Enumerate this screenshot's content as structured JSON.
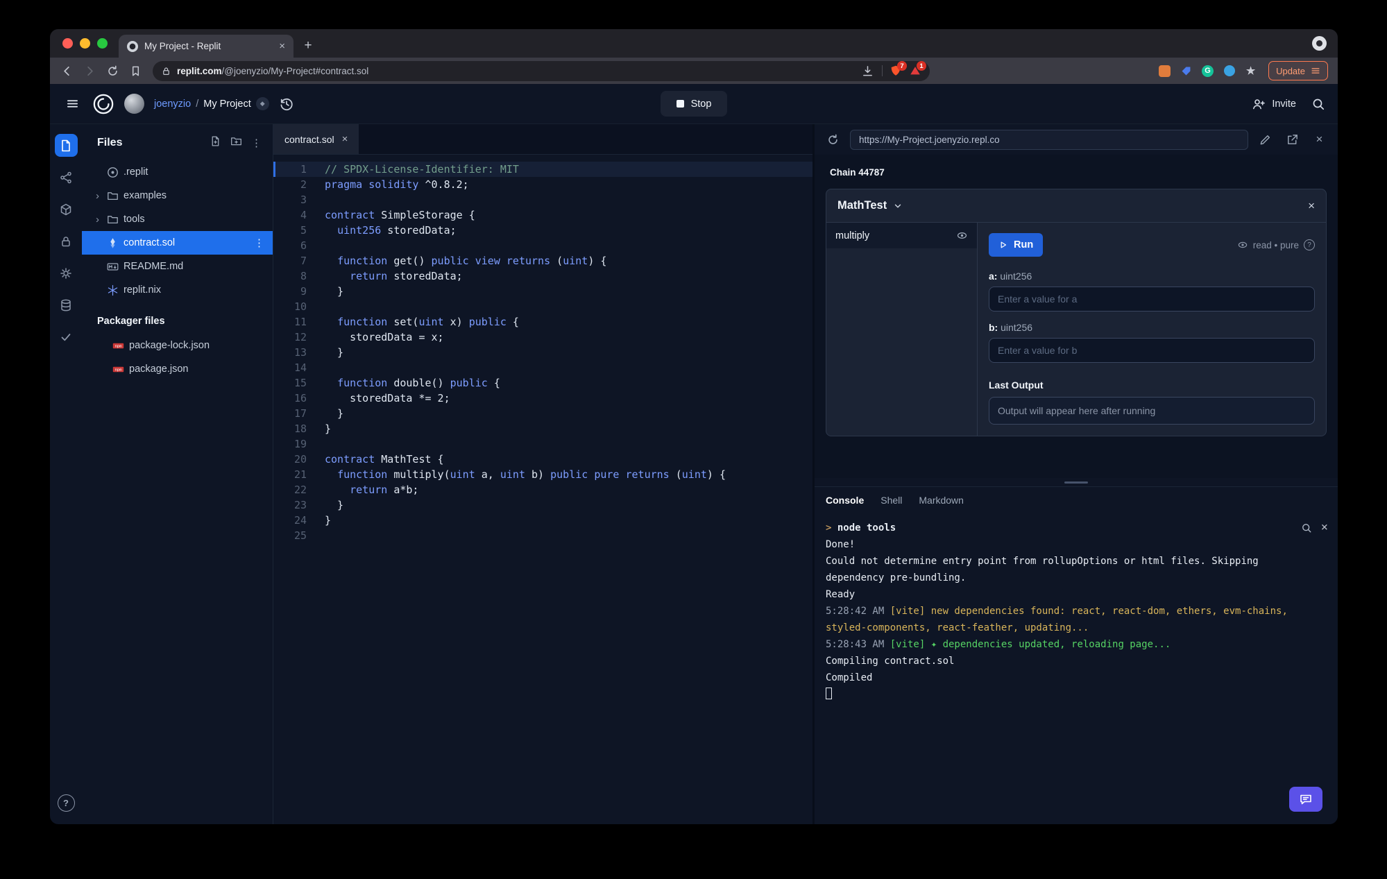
{
  "browser": {
    "tab_title": "My Project - Replit",
    "url_domain": "replit.com",
    "url_path": "/@joenyzio/My-Project#contract.sol",
    "shield_badge": "7",
    "alert_badge": "1",
    "update_label": "Update",
    "extension_letter": "G"
  },
  "header": {
    "username": "joenyzio",
    "separator": "/",
    "project_name": "My Project",
    "stop_label": "Stop",
    "invite_label": "Invite"
  },
  "rail": [
    {
      "name": "tool-files",
      "icon": "files-icon",
      "active": true
    },
    {
      "name": "tool-version-control",
      "icon": "version-control-icon"
    },
    {
      "name": "tool-packages",
      "icon": "packages-icon"
    },
    {
      "name": "tool-secrets",
      "icon": "secrets-icon"
    },
    {
      "name": "tool-settings",
      "icon": "settings-icon"
    },
    {
      "name": "tool-database",
      "icon": "database-icon"
    },
    {
      "name": "tool-checks",
      "icon": "check-icon"
    }
  ],
  "help_label": "?",
  "files": {
    "title": "Files",
    "items": [
      {
        "label": ".replit",
        "icon": "replit-icon"
      },
      {
        "label": "examples",
        "icon": "folder-icon",
        "chevron": true
      },
      {
        "label": "tools",
        "icon": "folder-icon",
        "chevron": true
      },
      {
        "label": "contract.sol",
        "icon": "solidity-icon",
        "selected": true
      },
      {
        "label": "README.md",
        "icon": "markdown-icon"
      },
      {
        "label": "replit.nix",
        "icon": "nix-icon"
      }
    ],
    "packager_title": "Packager files",
    "packager_items": [
      {
        "label": "package-lock.json",
        "icon": "npm-icon"
      },
      {
        "label": "package.json",
        "icon": "npm-icon"
      }
    ]
  },
  "editor": {
    "tab_label": "contract.sol",
    "highlight_line": 1,
    "lines": [
      [
        {
          "t": "c",
          "s": "// SPDX-License-Identifier: MIT"
        }
      ],
      [
        {
          "t": "k",
          "s": "pragma"
        },
        {
          "t": "p",
          "s": " "
        },
        {
          "t": "k",
          "s": "solidity"
        },
        {
          "t": "p",
          "s": " ^0.8.2;"
        }
      ],
      [],
      [
        {
          "t": "k",
          "s": "contract"
        },
        {
          "t": "p",
          "s": " SimpleStorage {"
        }
      ],
      [
        {
          "t": "p",
          "s": "  "
        },
        {
          "t": "k",
          "s": "uint256"
        },
        {
          "t": "p",
          "s": " storedData;"
        }
      ],
      [],
      [
        {
          "t": "p",
          "s": "  "
        },
        {
          "t": "k",
          "s": "function"
        },
        {
          "t": "p",
          "s": " get() "
        },
        {
          "t": "k",
          "s": "public view returns"
        },
        {
          "t": "p",
          "s": " ("
        },
        {
          "t": "k",
          "s": "uint"
        },
        {
          "t": "p",
          "s": ") {"
        }
      ],
      [
        {
          "t": "p",
          "s": "    "
        },
        {
          "t": "k",
          "s": "return"
        },
        {
          "t": "p",
          "s": " storedData;"
        }
      ],
      [
        {
          "t": "p",
          "s": "  }"
        }
      ],
      [],
      [
        {
          "t": "p",
          "s": "  "
        },
        {
          "t": "k",
          "s": "function"
        },
        {
          "t": "p",
          "s": " set("
        },
        {
          "t": "k",
          "s": "uint"
        },
        {
          "t": "p",
          "s": " x) "
        },
        {
          "t": "k",
          "s": "public"
        },
        {
          "t": "p",
          "s": " {"
        }
      ],
      [
        {
          "t": "p",
          "s": "    storedData = x;"
        }
      ],
      [
        {
          "t": "p",
          "s": "  }"
        }
      ],
      [],
      [
        {
          "t": "p",
          "s": "  "
        },
        {
          "t": "k",
          "s": "function"
        },
        {
          "t": "p",
          "s": " double() "
        },
        {
          "t": "k",
          "s": "public"
        },
        {
          "t": "p",
          "s": " {"
        }
      ],
      [
        {
          "t": "p",
          "s": "    storedData *= 2;"
        }
      ],
      [
        {
          "t": "p",
          "s": "  }"
        }
      ],
      [
        {
          "t": "p",
          "s": "}"
        }
      ],
      [],
      [
        {
          "t": "k",
          "s": "contract"
        },
        {
          "t": "p",
          "s": " MathTest {"
        }
      ],
      [
        {
          "t": "p",
          "s": "  "
        },
        {
          "t": "k",
          "s": "function"
        },
        {
          "t": "p",
          "s": " multiply("
        },
        {
          "t": "k",
          "s": "uint"
        },
        {
          "t": "p",
          "s": " a, "
        },
        {
          "t": "k",
          "s": "uint"
        },
        {
          "t": "p",
          "s": " b) "
        },
        {
          "t": "k",
          "s": "public pure returns"
        },
        {
          "t": "p",
          "s": " ("
        },
        {
          "t": "k",
          "s": "uint"
        },
        {
          "t": "p",
          "s": ") {"
        }
      ],
      [
        {
          "t": "p",
          "s": "    "
        },
        {
          "t": "k",
          "s": "return"
        },
        {
          "t": "p",
          "s": " a*b;"
        }
      ],
      [
        {
          "t": "p",
          "s": "  }"
        }
      ],
      [
        {
          "t": "p",
          "s": "}"
        }
      ],
      []
    ]
  },
  "webview": {
    "url": "https://My-Project.joenyzio.repl.co",
    "chain_label": "Chain 44787",
    "card": {
      "title": "MathTest",
      "method": "multiply",
      "run_label": "Run",
      "modifiers_text": "read • pure",
      "help_label": "?",
      "param_a_name": "a:",
      "param_a_type": "uint256",
      "param_a_placeholder": "Enter a value for a",
      "param_b_name": "b:",
      "param_b_type": "uint256",
      "param_b_placeholder": "Enter a value for b",
      "last_output_label": "Last Output",
      "output_placeholder": "Output will appear here after running"
    }
  },
  "console": {
    "tabs": [
      "Console",
      "Shell",
      "Markdown"
    ],
    "active_tab": "Console",
    "lines": [
      {
        "parts": [
          {
            "c": "prompt",
            "s": "> "
          },
          {
            "c": "cmd",
            "s": "node tools"
          }
        ]
      },
      {
        "parts": [
          {
            "c": "plain",
            "s": "Done!"
          }
        ]
      },
      {
        "parts": [
          {
            "c": "plain",
            "s": "Could not determine entry point from rollupOptions or html files. Skipping dependency pre-bundling."
          }
        ]
      },
      {
        "parts": [
          {
            "c": "plain",
            "s": "Ready"
          }
        ]
      },
      {
        "parts": [
          {
            "c": "dim",
            "s": "5:28:42 AM "
          },
          {
            "c": "yellow",
            "s": "[vite] new dependencies found: react, react-dom, ethers, evm-chains, styled-components, react-feather, updating..."
          }
        ]
      },
      {
        "parts": [
          {
            "c": "dim",
            "s": "5:28:43 AM "
          },
          {
            "c": "green",
            "s": "[vite] ✦ dependencies updated, reloading page..."
          }
        ]
      },
      {
        "parts": [
          {
            "c": "plain",
            "s": "Compiling contract.sol"
          }
        ]
      },
      {
        "parts": [
          {
            "c": "plain",
            "s": "Compiled"
          }
        ]
      },
      {
        "parts": [],
        "cursor": true
      }
    ]
  },
  "colors": {
    "accent_blue": "#1f6feb",
    "run_button": "#2160d9",
    "console_yellow": "#d9b55a",
    "console_green": "#56d364",
    "console_prompt_orange": "#e0af68",
    "npm_red": "#cb3837",
    "brave_orange": "#fb542b",
    "update_orange": "#ff7a4f",
    "chat_button": "#5b51e8",
    "traffic_red": "#ff5f57",
    "traffic_yellow": "#febc2e",
    "traffic_green": "#28c840"
  }
}
